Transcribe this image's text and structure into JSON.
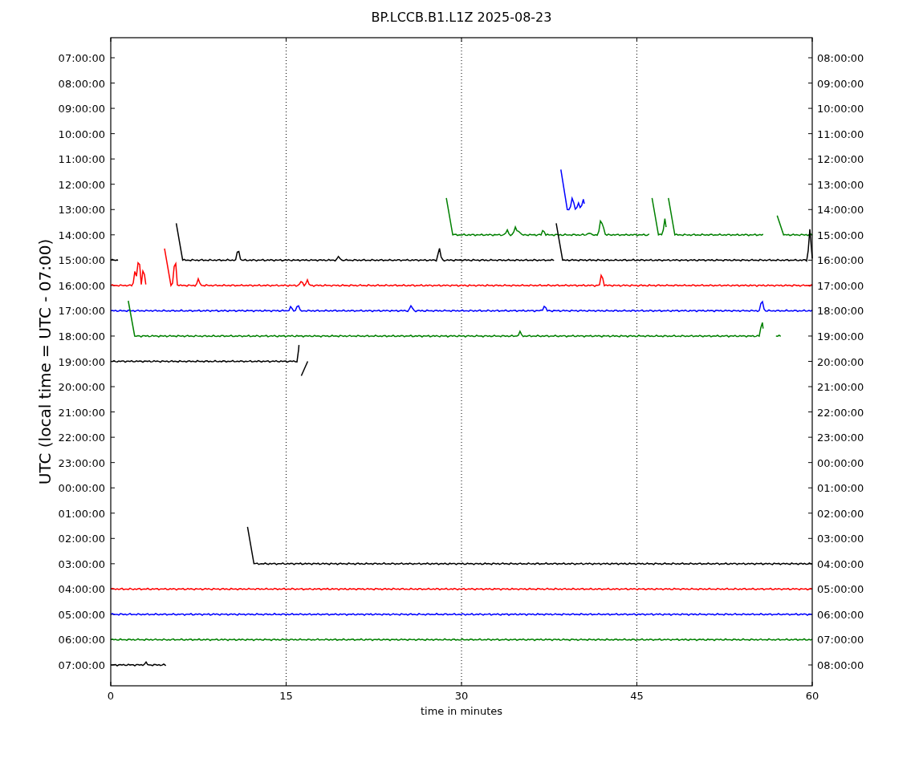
{
  "title": "BP.LCCB.B1.L1Z 2025-08-23",
  "ylabel": "UTC (local time = UTC - 07:00)",
  "xlabel": "time in minutes",
  "xticks": [
    "0",
    "15",
    "30",
    "45",
    "60"
  ],
  "left_labels": [
    "07:00:00",
    "08:00:00",
    "09:00:00",
    "10:00:00",
    "11:00:00",
    "12:00:00",
    "13:00:00",
    "14:00:00",
    "15:00:00",
    "16:00:00",
    "17:00:00",
    "18:00:00",
    "19:00:00",
    "20:00:00",
    "21:00:00",
    "22:00:00",
    "23:00:00",
    "00:00:00",
    "01:00:00",
    "02:00:00",
    "03:00:00",
    "04:00:00",
    "05:00:00",
    "06:00:00",
    "07:00:00"
  ],
  "right_labels": [
    "08:00:00",
    "09:00:00",
    "10:00:00",
    "11:00:00",
    "12:00:00",
    "13:00:00",
    "14:00:00",
    "15:00:00",
    "16:00:00",
    "17:00:00",
    "18:00:00",
    "19:00:00",
    "20:00:00",
    "21:00:00",
    "22:00:00",
    "23:00:00",
    "00:00:00",
    "01:00:00",
    "02:00:00",
    "03:00:00",
    "04:00:00",
    "05:00:00",
    "06:00:00",
    "07:00:00",
    "08:00:00"
  ],
  "traces": [
    {
      "color": "#0000ff"
    },
    {
      "color": "#008000"
    },
    {
      "color": "#000000"
    },
    {
      "color": "#ff0000"
    },
    {
      "color": "#0000ff"
    },
    {
      "color": "#008000"
    },
    {
      "color": "#000000"
    },
    {
      "color": "#000000"
    },
    {
      "color": "#ff0000"
    },
    {
      "color": "#0000ff"
    },
    {
      "color": "#008000"
    },
    {
      "color": "#000000"
    }
  ]
}
